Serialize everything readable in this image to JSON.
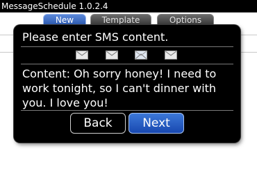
{
  "window": {
    "title": "MessageSchedule 1.0.2.4"
  },
  "tabs": [
    {
      "label": "New",
      "active": true
    },
    {
      "label": "Template",
      "active": false
    },
    {
      "label": "Options",
      "active": false
    }
  ],
  "dialog": {
    "prompt": "Please enter SMS content.",
    "icons": [
      "envelope-icon",
      "envelope-icon",
      "open-envelope-icon",
      "envelope-icon"
    ],
    "content_text": "Content: Oh sorry honey! I need to work tonight, so I can't dinner with you. I love you!",
    "back_label": "Back",
    "next_label": "Next"
  },
  "colors": {
    "titlebar": "#000000",
    "active_tab": "#2f62c4",
    "dialog_bg": "#000000",
    "next_button": "#2a5fc6"
  }
}
